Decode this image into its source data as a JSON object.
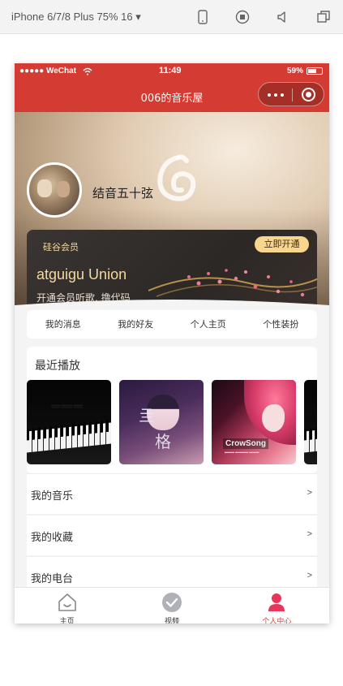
{
  "devtools": {
    "device_label": "iPhone 6/7/8 Plus 75% 16 ▾"
  },
  "status_bar": {
    "carrier": "●●●●● WeChat",
    "time": "11:49",
    "battery": "59%"
  },
  "nav": {
    "title": "006的音乐屋"
  },
  "profile": {
    "nickname": "结音五十弦"
  },
  "vip": {
    "label": "硅谷会员",
    "button": "立即开通",
    "title": "atguigu Union",
    "desc": "开通会员听歌, 撸代码"
  },
  "menu": {
    "items": [
      {
        "label": "我的消息"
      },
      {
        "label": "我的好友"
      },
      {
        "label": "个人主页"
      },
      {
        "label": "个性装扮"
      }
    ]
  },
  "recent": {
    "title": "最近播放",
    "albums": [
      {
        "icon": "piano-album-cover"
      },
      {
        "icon": "anime-girl-album-cover",
        "text_1": "亖",
        "text_2": "格"
      },
      {
        "icon": "crowsong-album-cover",
        "logo": "CrowSong"
      },
      {
        "icon": "piano-album-cover"
      }
    ]
  },
  "list": {
    "items": [
      {
        "label": "我的音乐",
        "arrow": ">"
      },
      {
        "label": "我的收藏",
        "arrow": ">"
      },
      {
        "label": "我的电台",
        "arrow": ">"
      }
    ]
  },
  "tabbar": {
    "items": [
      {
        "label": "主页",
        "icon": "home-icon"
      },
      {
        "label": "视频",
        "icon": "video-check-icon"
      },
      {
        "label": "个人中心",
        "icon": "person-icon",
        "active": true
      }
    ]
  },
  "colors": {
    "brand_red": "#d43c33",
    "vip_gold": "#f5d9a0"
  }
}
